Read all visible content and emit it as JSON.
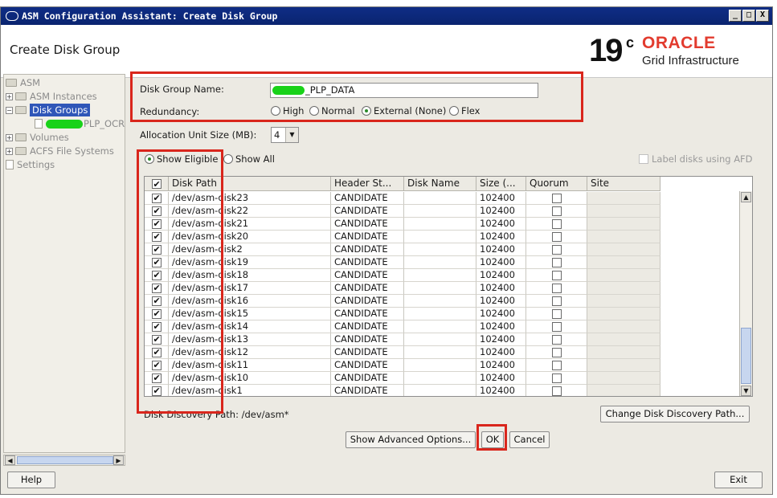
{
  "window": {
    "title": "ASM Configuration Assistant: Create Disk Group",
    "controls": [
      "_",
      "□",
      "X"
    ]
  },
  "header": {
    "page_title": "Create Disk Group",
    "version": "19",
    "version_sup": "c",
    "brand": "ORACLE",
    "product": "Grid Infrastructure"
  },
  "nav": {
    "items": [
      {
        "label": "ASM"
      },
      {
        "label": "ASM Instances"
      },
      {
        "label": "Disk Groups"
      },
      {
        "label": "PLP_OCR"
      },
      {
        "label": "Volumes"
      },
      {
        "label": "ACFS File Systems"
      },
      {
        "label": "Settings"
      }
    ]
  },
  "form": {
    "disk_group_name_label": "Disk Group Name:",
    "disk_group_name_value": "_PLP_DATA",
    "redundancy_label": "Redundancy:",
    "redundancy_options": [
      "High",
      "Normal",
      "External (None)",
      "Flex"
    ],
    "redundancy_selected": "External (None)",
    "allocation_label": "Allocation Unit Size (MB):",
    "allocation_value": "4",
    "show_eligible": "Show Eligible",
    "show_all": "Show All",
    "label_disks_afd": "Label disks using AFD"
  },
  "table": {
    "columns": [
      "Disk Path",
      "Header St...",
      "Disk Name",
      "Size (...",
      "Quorum",
      "Site"
    ],
    "rows": [
      {
        "path": "/dev/asm-disk23",
        "status": "CANDIDATE",
        "size": "102400"
      },
      {
        "path": "/dev/asm-disk22",
        "status": "CANDIDATE",
        "size": "102400"
      },
      {
        "path": "/dev/asm-disk21",
        "status": "CANDIDATE",
        "size": "102400"
      },
      {
        "path": "/dev/asm-disk20",
        "status": "CANDIDATE",
        "size": "102400"
      },
      {
        "path": "/dev/asm-disk2",
        "status": "CANDIDATE",
        "size": "102400"
      },
      {
        "path": "/dev/asm-disk19",
        "status": "CANDIDATE",
        "size": "102400"
      },
      {
        "path": "/dev/asm-disk18",
        "status": "CANDIDATE",
        "size": "102400"
      },
      {
        "path": "/dev/asm-disk17",
        "status": "CANDIDATE",
        "size": "102400"
      },
      {
        "path": "/dev/asm-disk16",
        "status": "CANDIDATE",
        "size": "102400"
      },
      {
        "path": "/dev/asm-disk15",
        "status": "CANDIDATE",
        "size": "102400"
      },
      {
        "path": "/dev/asm-disk14",
        "status": "CANDIDATE",
        "size": "102400"
      },
      {
        "path": "/dev/asm-disk13",
        "status": "CANDIDATE",
        "size": "102400"
      },
      {
        "path": "/dev/asm-disk12",
        "status": "CANDIDATE",
        "size": "102400"
      },
      {
        "path": "/dev/asm-disk11",
        "status": "CANDIDATE",
        "size": "102400"
      },
      {
        "path": "/dev/asm-disk10",
        "status": "CANDIDATE",
        "size": "102400"
      },
      {
        "path": "/dev/asm-disk1",
        "status": "CANDIDATE",
        "size": "102400"
      }
    ]
  },
  "discovery": {
    "label": "Disk Discovery Path:",
    "path": "/dev/asm*",
    "change_button": "Change Disk Discovery Path..."
  },
  "actions": {
    "advanced": "Show Advanced Options...",
    "ok": "OK",
    "cancel": "Cancel",
    "help": "Help",
    "exit": "Exit"
  },
  "colors": {
    "title_bar": "#0a2470",
    "oracle_red": "#e23b2e",
    "highlight_red": "#d9261c",
    "selection": "#2f56b8"
  }
}
